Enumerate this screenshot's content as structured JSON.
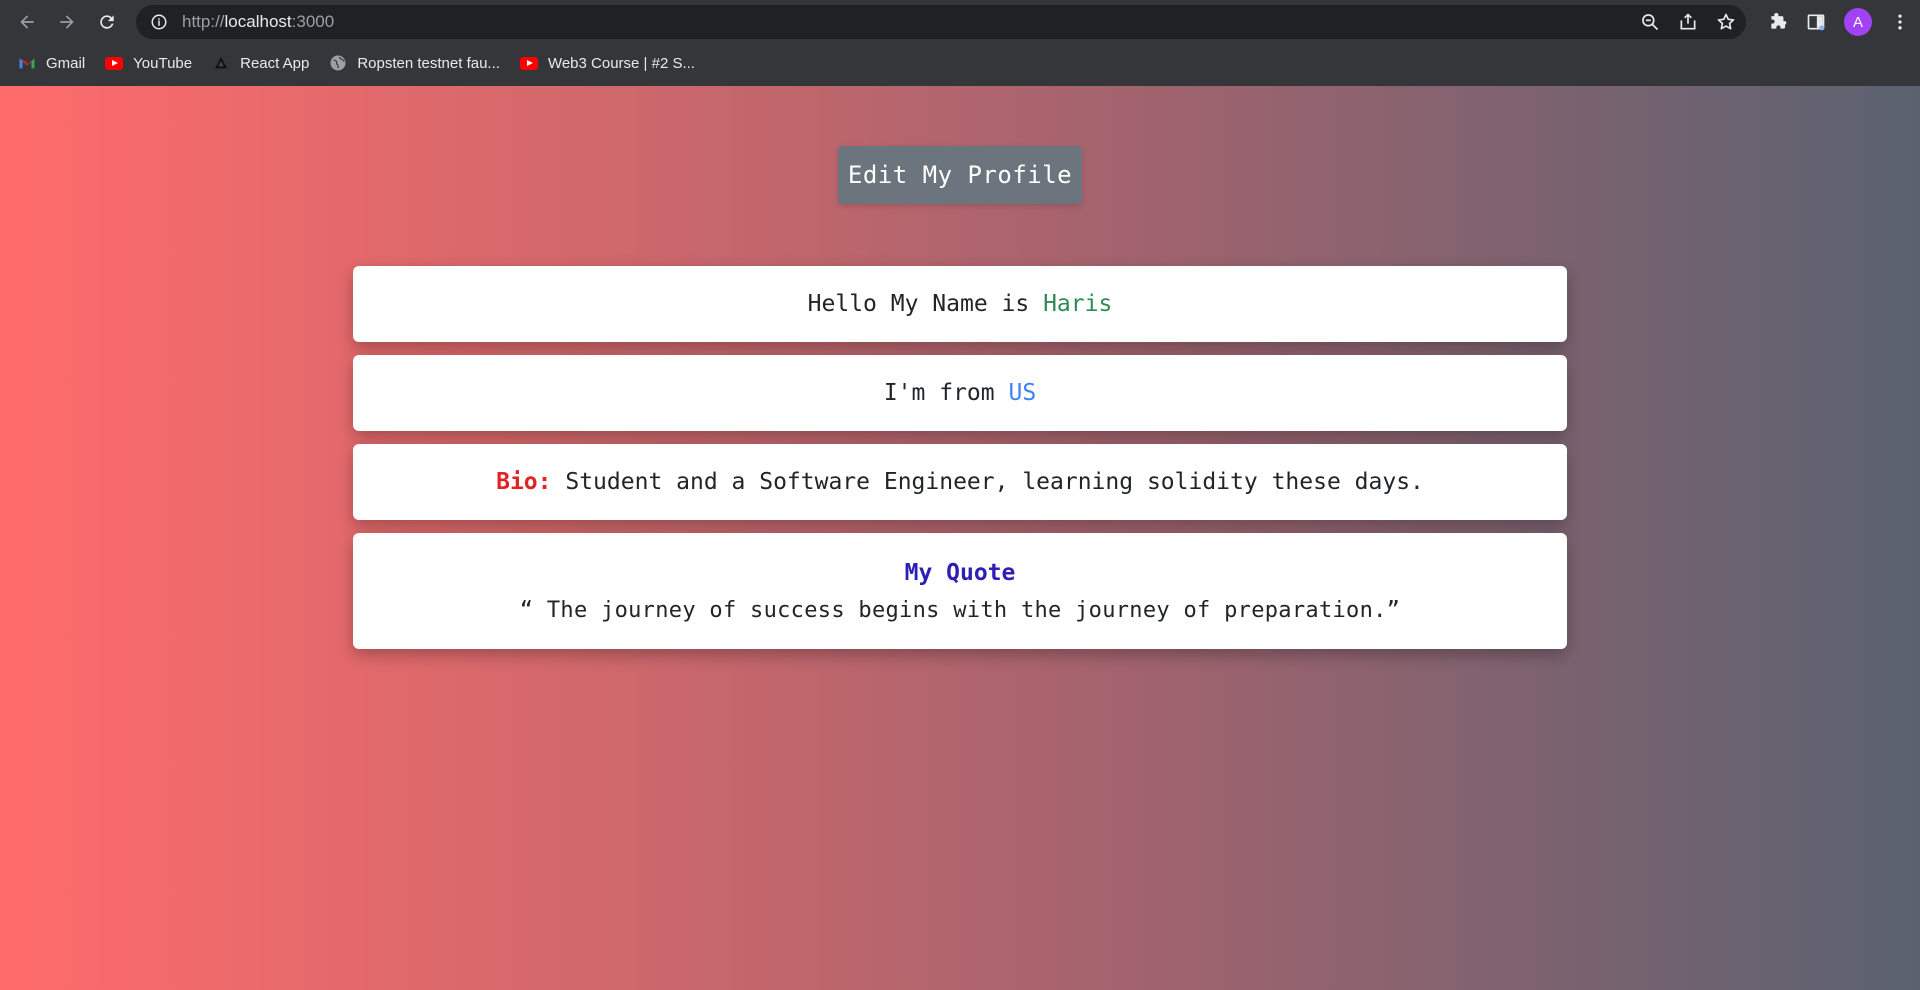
{
  "browser": {
    "url_scheme": "http://",
    "url_host": "localhost",
    "url_port": ":3000",
    "avatar_letter": "A",
    "bookmarks": [
      {
        "label": "Gmail",
        "icon": "gmail-icon"
      },
      {
        "label": "YouTube",
        "icon": "youtube-icon"
      },
      {
        "label": "React App",
        "icon": "react-app-icon"
      },
      {
        "label": "Ropsten testnet fau...",
        "icon": "globe-icon"
      },
      {
        "label": "Web3 Course | #2 S...",
        "icon": "youtube-icon"
      }
    ]
  },
  "profile": {
    "edit_button": "Edit My Profile",
    "name_prefix": "Hello My Name is",
    "name": "Haris",
    "from_prefix": "I'm from",
    "country": "US",
    "bio_label": "Bio:",
    "bio_text": "Student and a Software Engineer, learning solidity these days.",
    "quote_title": "My Quote",
    "quote_text": "“ The journey of success begins with the journey of preparation.”"
  },
  "colors": {
    "name": "#2e8b57",
    "country": "#3b82f6",
    "bio_label": "#e02424",
    "quote_title": "#2d1fb5",
    "button": "#6c757d"
  }
}
